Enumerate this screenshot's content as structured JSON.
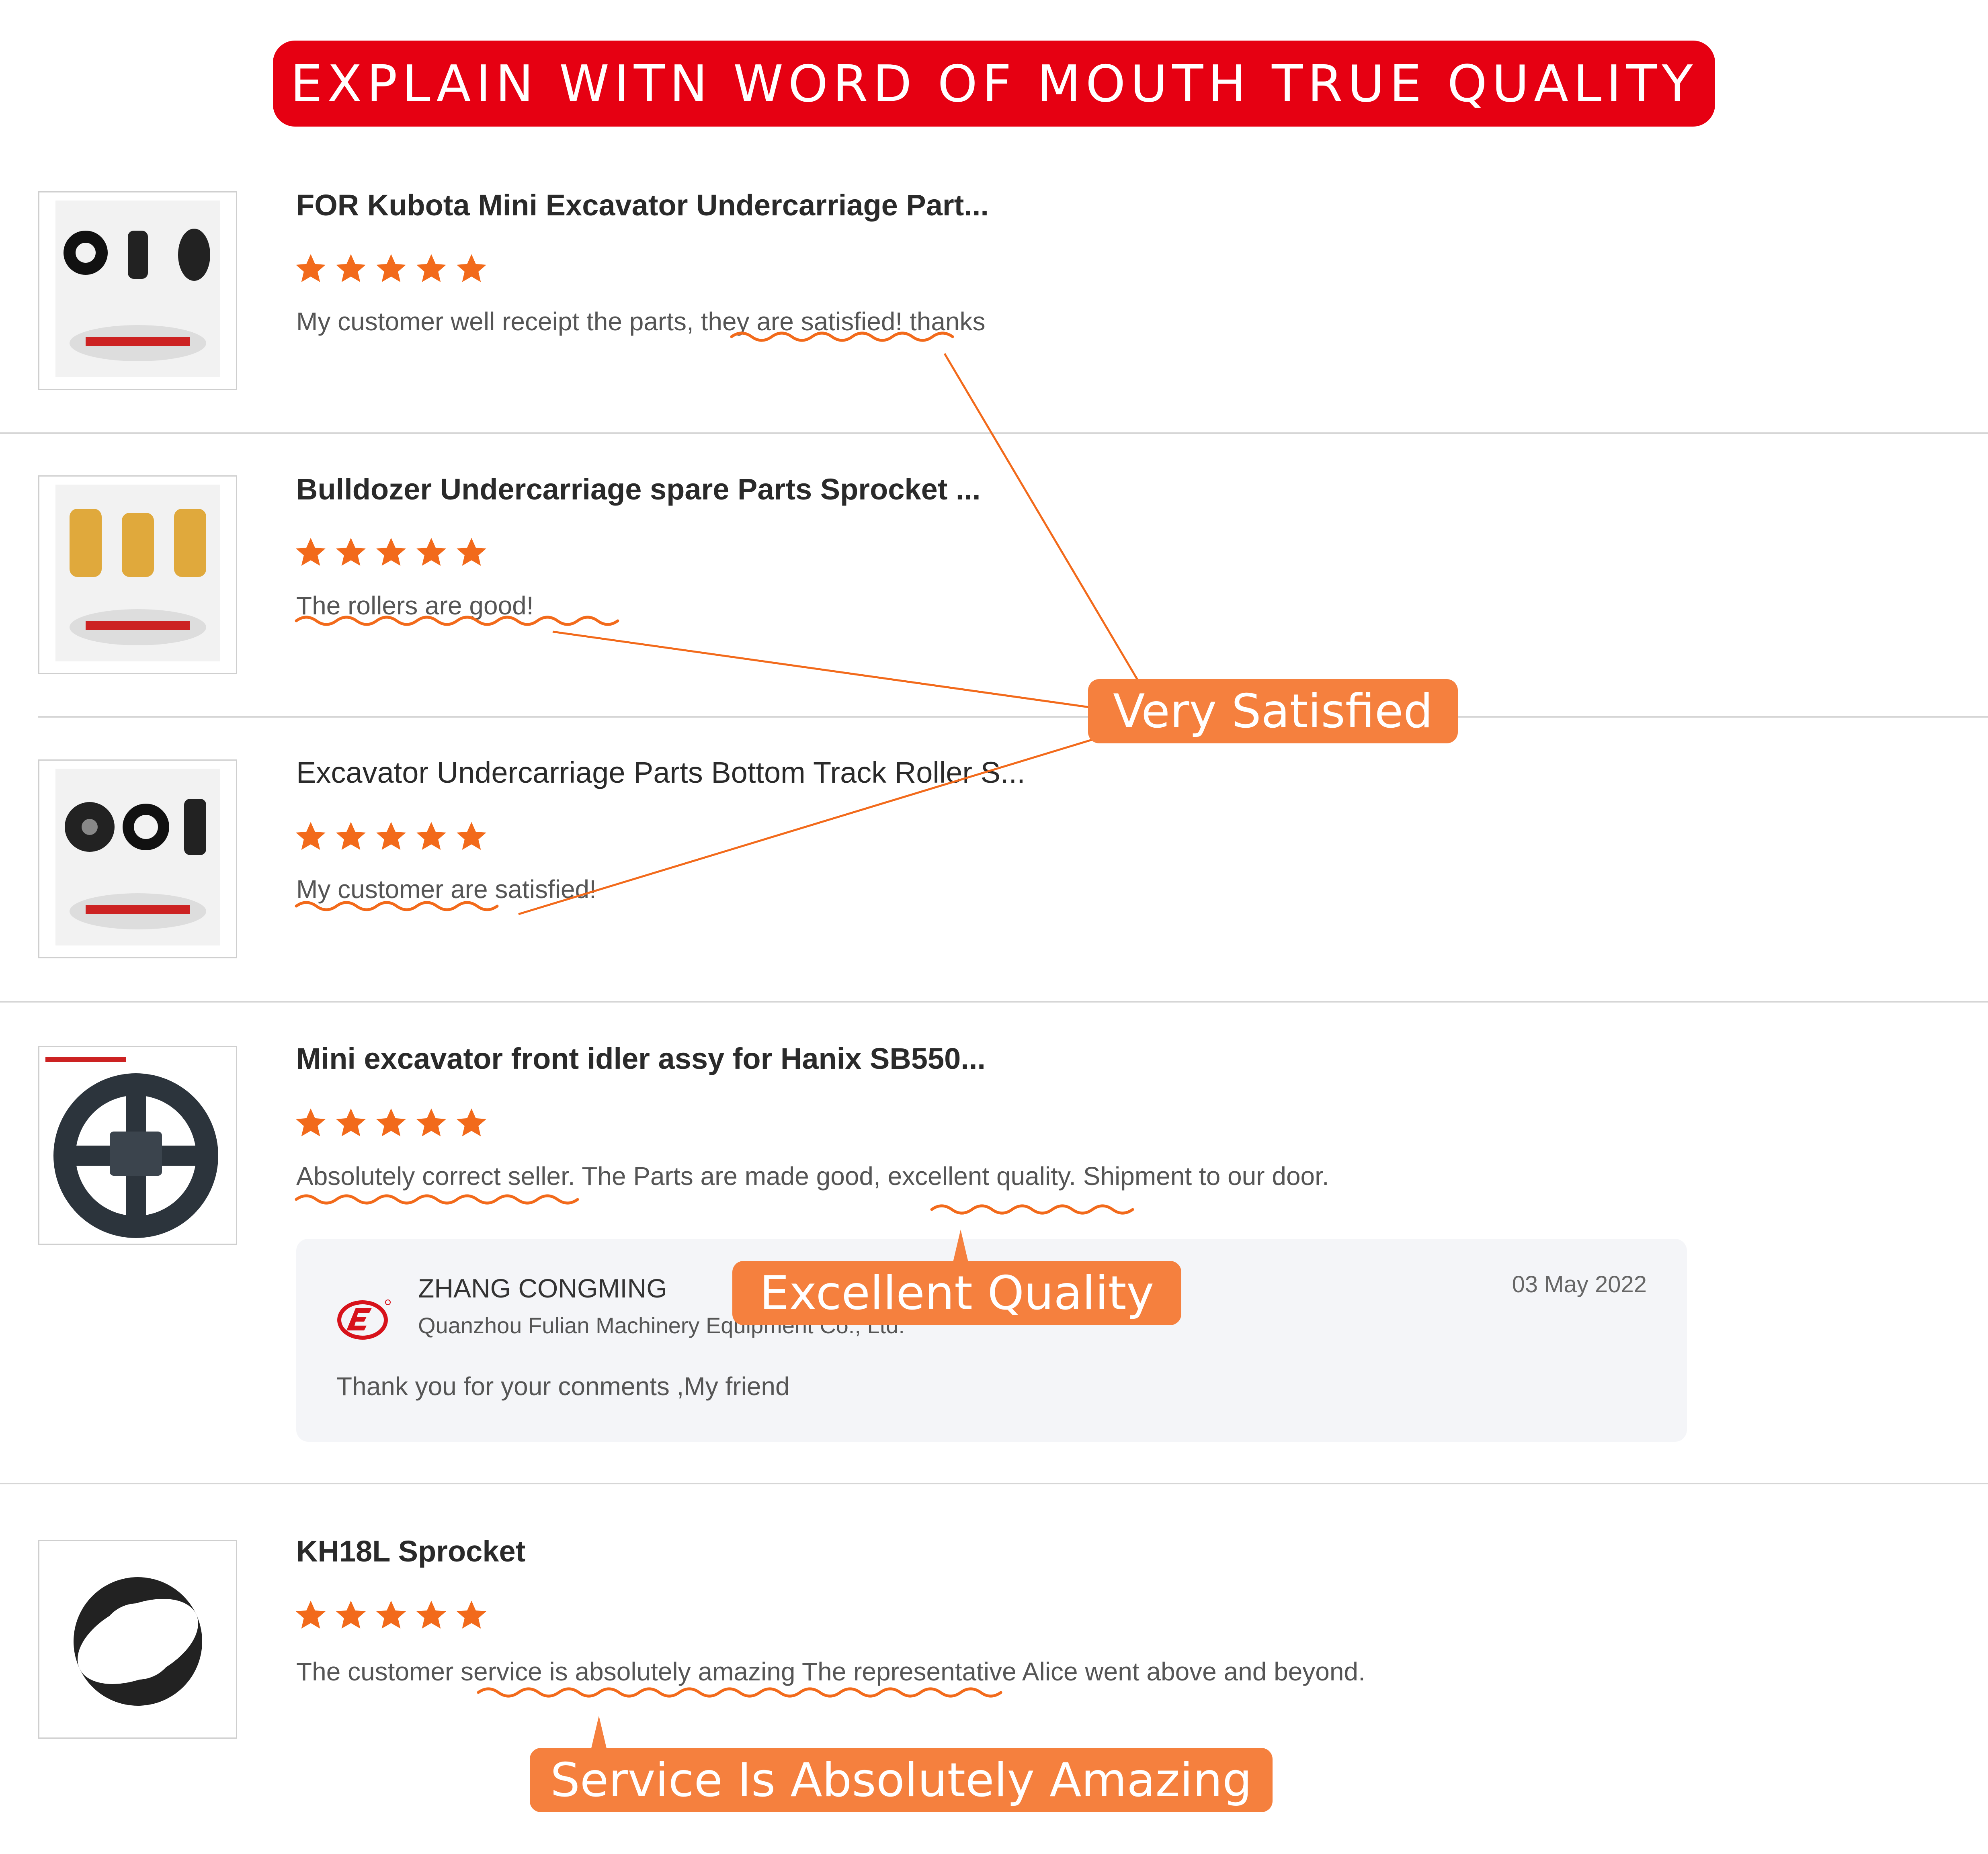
{
  "banner": {
    "title": "EXPLAIN WITN WORD OF MOUTH TRUE QUALITY"
  },
  "reviews": [
    {
      "title": "FOR Kubota Mini Excavator Undercarriage Part...",
      "rating": 5,
      "text": "My customer well receipt the parts, they are satisfied! thanks"
    },
    {
      "title": "Bulldozer Undercarriage spare Parts Sprocket ...",
      "rating": 5,
      "text": "The rollers are good!"
    },
    {
      "title": "Excavator Undercarriage Parts Bottom Track Roller S...",
      "rating": 5,
      "text": "My customer are satisfied!"
    },
    {
      "title": "Mini excavator front idler assy for Hanix SB550...",
      "rating": 5,
      "text": "Absolutely correct seller. The Parts are made good, excellent quality. Shipment to our door."
    },
    {
      "title": "KH18L Sprocket",
      "rating": 5,
      "text": "The customer service is absolutely amazing The representative Alice went above and beyond."
    }
  ],
  "reply": {
    "name": "ZHANG CONGMING",
    "company": "Quanzhou Fulian Machinery Equipment Co., Ltd.",
    "date": "03 May 2022",
    "message": "Thank you for your conments ,My friend"
  },
  "callouts": {
    "very_satisfied": "Very Satisfied",
    "excellent_quality": "Excellent Quality",
    "service": "Service Is Absolutely Amazing"
  },
  "colors": {
    "banner": "#e60012",
    "callout": "#f5803e",
    "star": "#f26a1b"
  },
  "icons": [
    "star-icon",
    "company-logo-icon"
  ]
}
